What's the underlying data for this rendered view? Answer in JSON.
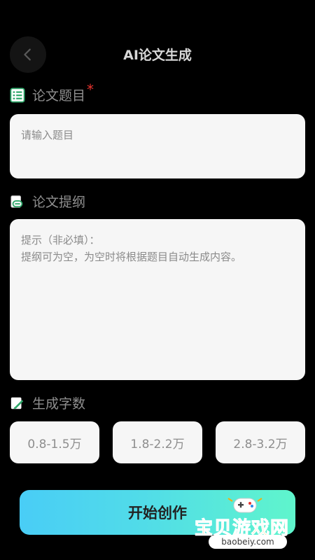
{
  "header": {
    "title": "AI论文生成"
  },
  "topic": {
    "label": "论文题目",
    "required_mark": "*",
    "placeholder": "请输入题目"
  },
  "outline": {
    "label": "论文提纲",
    "hint_line1": "提示（非必填）：",
    "hint_line2": "提纲可为空，为空时将根据题目自动生成内容。"
  },
  "word_count": {
    "label": "生成字数",
    "options": [
      "0.8-1.5万",
      "1.8-2.2万",
      "2.8-3.2万"
    ]
  },
  "start_button": {
    "label": "开始创作"
  },
  "watermark": {
    "text": "宝贝游戏网",
    "url": "baobeiy.com"
  },
  "colors": {
    "background": "#000000",
    "required": "#e8332f",
    "gradient_start": "#49cdf6",
    "gradient_end": "#5ff5cc",
    "accent_green": "#2ea86a"
  },
  "icons": [
    "chevron-left-icon",
    "list-icon",
    "outline-icon",
    "edit-icon",
    "gamepad-icon"
  ]
}
